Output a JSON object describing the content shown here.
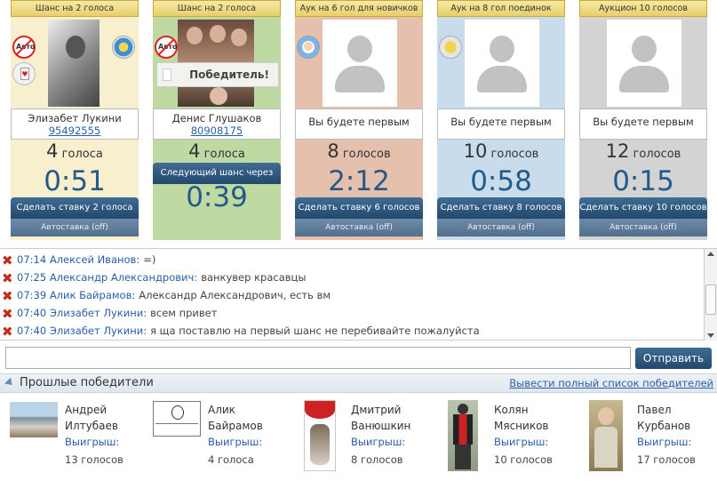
{
  "auctions": [
    {
      "title": "Шанс на 2 голоса",
      "name": "Элизабет Лукини",
      "id": "95492555",
      "votes_num": "4",
      "votes_word": "голоса",
      "timer": "0:51",
      "bid": "Сделать ставку 2 голоса",
      "auto": "Автоставка (off)",
      "color": "#f7efcd",
      "photo": "#cfcfcf"
    },
    {
      "title": "Шанс на 2 голоса",
      "name": "Денис Глушаков",
      "id": "80908175",
      "votes_num": "4",
      "votes_word": "голоса",
      "next": "Следующий шанс через",
      "timer": "0:39",
      "winner_badge": "Победитель!",
      "color": "#bfd9a2",
      "photo": "#7b5a48"
    },
    {
      "title": "Аук на 6 гол для новичков",
      "placeholder": "Вы будете первым",
      "votes_num": "8",
      "votes_word": "голосов",
      "timer": "2:12",
      "bid": "Сделать ставку 6 голосов",
      "auto": "Автоставка (off)",
      "color": "#e5c1ad"
    },
    {
      "title": "Аук на 8 гол поединок",
      "placeholder": "Вы будете первым",
      "votes_num": "10",
      "votes_word": "голосов",
      "timer": "0:58",
      "bid": "Сделать ставку 8 голосов",
      "auto": "Автоставка (off)",
      "color": "#c8dceb"
    },
    {
      "title": "Аукцион 10 голосов",
      "placeholder": "Вы будете первым",
      "votes_num": "12",
      "votes_word": "голосов",
      "timer": "0:15",
      "bid": "Сделать ставку 10 голосов",
      "auto": "Автоставка (off)",
      "color": "#d3d3d3"
    }
  ],
  "icons": {
    "auto_badge": "Авто"
  },
  "chat": [
    {
      "time": "07:14",
      "name": "Алексей Иванов:",
      "text": "=)"
    },
    {
      "time": "07:25",
      "name": "Александр Александрович:",
      "text": "ванкувер красавцы"
    },
    {
      "time": "07:39",
      "name": "Алик Байрамов:",
      "text": "Александр Александрович, есть вм"
    },
    {
      "time": "07:40",
      "name": "Элизабет Лукини:",
      "text": "всем привет"
    },
    {
      "time": "07:40",
      "name": "Элизабет Лукини:",
      "text": "я ща поставлю на первый шанс не перебивайте пожалуйста"
    }
  ],
  "input": {
    "value": "",
    "send": "Отправить"
  },
  "winners": {
    "title": "Прошлые победители",
    "full_list": "Вывести полный список победителей",
    "items": [
      {
        "first": "Андрей",
        "last": "Илтубаев",
        "label": "Выигрыш:",
        "prize": "13 голосов"
      },
      {
        "first": "Алик",
        "last": "Байрамов",
        "label": "Выигрыш:",
        "prize": "4 голоса"
      },
      {
        "first": "Дмитрий",
        "last": "Ванюшкин",
        "label": "Выигрыш:",
        "prize": "8 голосов"
      },
      {
        "first": "Колян",
        "last": "Мясников",
        "label": "Выигрыш:",
        "prize": "10 голосов"
      },
      {
        "first": "Павел",
        "last": "Курбанов",
        "label": "Выигрыш:",
        "prize": "17 голосов"
      }
    ]
  }
}
